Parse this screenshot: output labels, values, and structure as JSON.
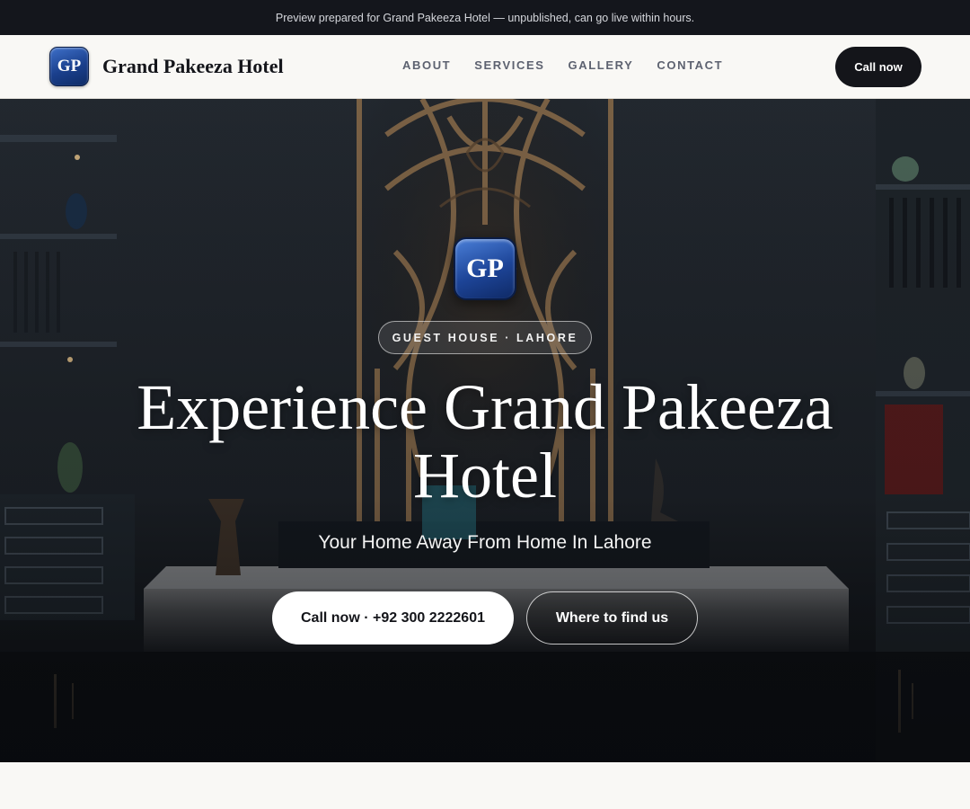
{
  "preview_banner": {
    "text": "Preview prepared for Grand Pakeeza Hotel — unpublished, can go live within hours."
  },
  "header": {
    "logo_initials": "GP",
    "brand_name": "Grand Pakeeza Hotel",
    "nav": [
      {
        "label": "ABOUT"
      },
      {
        "label": "SERVICES"
      },
      {
        "label": "GALLERY"
      },
      {
        "label": "CONTACT"
      }
    ],
    "call_button": "Call now"
  },
  "hero": {
    "badge_initials": "GP",
    "kicker": "GUEST HOUSE · LAHORE",
    "title": "Experience Grand Pakeeza Hotel",
    "subtitle": "Your Home Away From Home In Lahore",
    "primary_button": "Call now · +92 300 2222601",
    "secondary_button": "Where to find us"
  },
  "colors": {
    "dark": "#14151a",
    "page_bg": "#f9f8f5",
    "brand_blue": "#1d4497",
    "lattice_gold": "#b38a5c"
  }
}
